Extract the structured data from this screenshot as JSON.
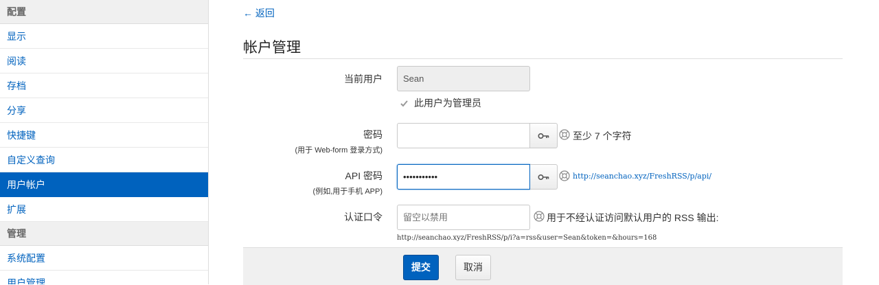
{
  "sidebar": {
    "sections": [
      {
        "header": "配置",
        "items": [
          {
            "label": "显示",
            "active": false
          },
          {
            "label": "阅读",
            "active": false
          },
          {
            "label": "存档",
            "active": false
          },
          {
            "label": "分享",
            "active": false
          },
          {
            "label": "快捷键",
            "active": false
          },
          {
            "label": "自定义查询",
            "active": false
          },
          {
            "label": "用户帐户",
            "active": true
          },
          {
            "label": "扩展",
            "active": false
          }
        ]
      },
      {
        "header": "管理",
        "items": [
          {
            "label": "系统配置",
            "active": false
          },
          {
            "label": "用户管理",
            "active": false
          }
        ]
      }
    ]
  },
  "main": {
    "back_label": "← 返回",
    "title": "帐户管理",
    "current_user": {
      "label": "当前用户",
      "value": "Sean"
    },
    "is_admin": {
      "label": "此用户为管理员",
      "checked": true
    },
    "password": {
      "label": "密码",
      "sublabel": "(用于 Web-form 登录方式)",
      "value": "",
      "help": "至少 7 个字符"
    },
    "api_password": {
      "label": "API 密码",
      "sublabel": "(例如,用于手机 APP)",
      "value": "•••••••••••",
      "help_url": "http://seanchao.xyz/FreshRSS/p/api/"
    },
    "token": {
      "label": "认证口令",
      "placeholder": "留空以禁用",
      "help": "用于不经认证访问默认用户的 RSS 输出:",
      "url": "http://seanchao.xyz/FreshRSS/p/i?a=rss&user=Sean&token=&hours=168"
    },
    "submit_label": "提交",
    "cancel_label": "取消"
  },
  "colors": {
    "accent": "#0062be",
    "sidebar_header_bg": "#f0f0f0",
    "footer_bg": "#f0f0f0"
  }
}
